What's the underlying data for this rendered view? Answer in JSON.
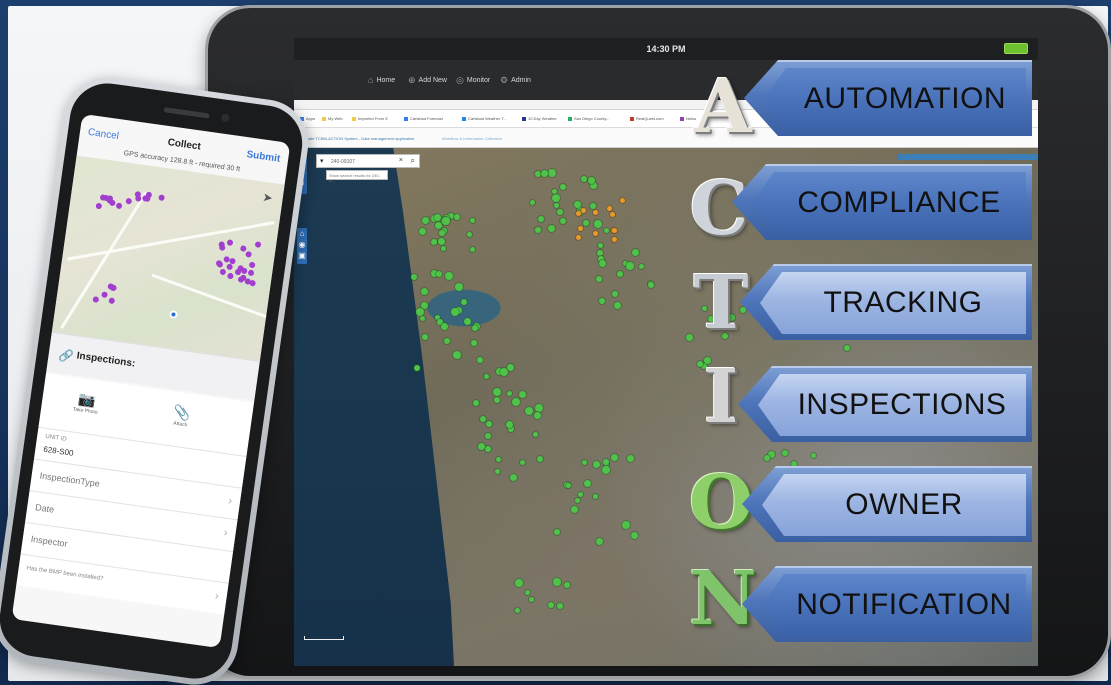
{
  "tablet": {
    "status_time": "14:30 PM",
    "nav": [
      "Home",
      "Add New",
      "Monitor",
      "Admin"
    ],
    "bookmarks": [
      "Apps",
      "My Web",
      "Imported From E",
      "Carlsbad Forecast",
      "Carlsbad Weather T...",
      "10 Day Weather",
      "San Diego County...",
      "RealQuest.com",
      "Nelso"
    ],
    "app_title": "Private TCBM-ACTION System - Data management application",
    "app_subtitle": "Workflow & Information Collection",
    "search_value": "240-09107",
    "search_suggestion": "Show search results for 240-0..."
  },
  "action": {
    "letters": [
      "A",
      "C",
      "T",
      "I",
      "O",
      "N"
    ],
    "banners": [
      "AUTOMATION",
      "COMPLIANCE",
      "TRACKING",
      "INSPECTIONS",
      "OWNER",
      "NOTIFICATION"
    ]
  },
  "colors": {
    "banner_blue": "#4f76ba",
    "marker_green": "#4fc24a",
    "marker_orange": "#e79a2c",
    "phone_marker": "#a23fcf"
  },
  "phone": {
    "cancel": "Cancel",
    "title": "Collect",
    "submit": "Submit",
    "gps": "GPS accuracy 128.8 ft - required 30 ft",
    "section_title": "Inspections:",
    "take_photo": "Take Photo",
    "attach": "Attach",
    "unit_label": "UNIT ID",
    "unit_value": "628-S00",
    "inspection_type": "InspectionType",
    "date": "Date",
    "inspector": "Inspector",
    "footer": "Has the BMP been installed?"
  }
}
